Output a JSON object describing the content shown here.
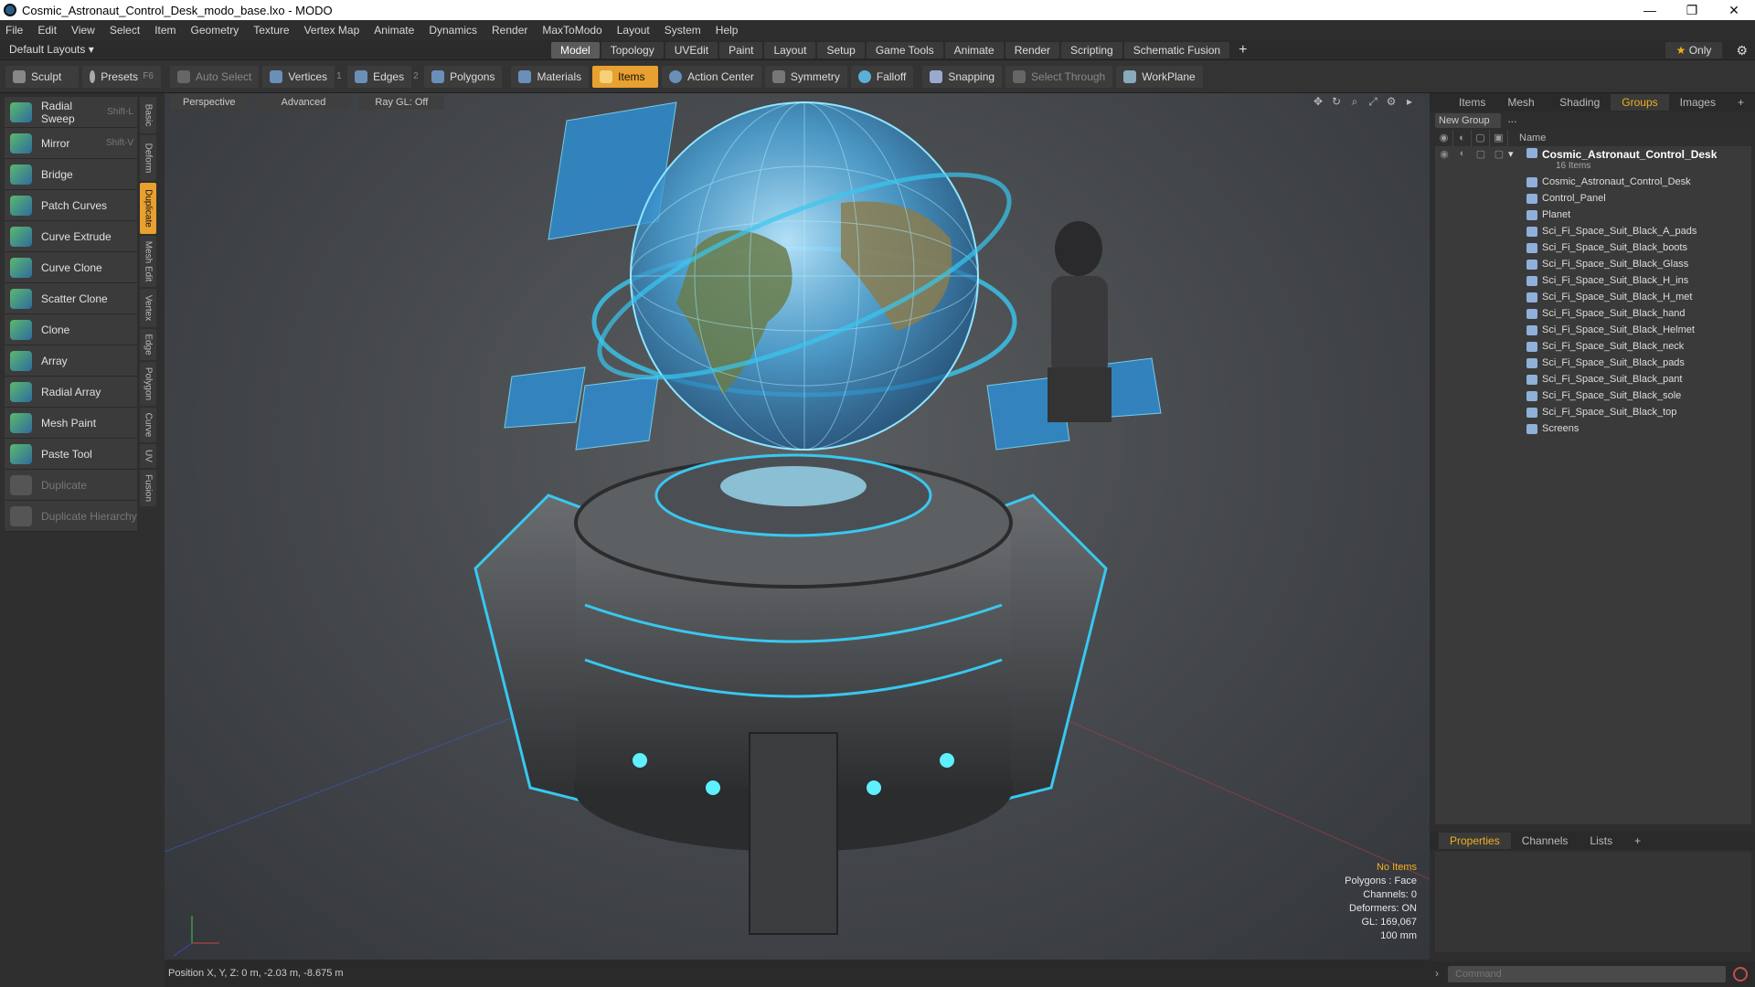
{
  "window": {
    "title": "Cosmic_Astronaut_Control_Desk_modo_base.lxo - MODO",
    "controls": [
      "—",
      "❐",
      "✕"
    ]
  },
  "menubar": [
    "File",
    "Edit",
    "View",
    "Select",
    "Item",
    "Geometry",
    "Texture",
    "Vertex Map",
    "Animate",
    "Dynamics",
    "Render",
    "MaxToModo",
    "Layout",
    "System",
    "Help"
  ],
  "layout": {
    "dropdown": "Default Layouts ▾",
    "tabs": [
      "Model",
      "Topology",
      "UVEdit",
      "Paint",
      "Layout",
      "Setup",
      "Game Tools",
      "Animate",
      "Render",
      "Scripting",
      "Schematic Fusion"
    ],
    "active_tab": "Model",
    "plus": "+",
    "only": "Only"
  },
  "toolbar": {
    "sculpt": "Sculpt",
    "presets": "Presets",
    "presets_sc": "F6",
    "auto_select": "Auto Select",
    "vertices": "Vertices",
    "vertices_n": "1",
    "edges": "Edges",
    "edges_n": "2",
    "polygons": "Polygons",
    "materials": "Materials",
    "items": "Items",
    "action_center": "Action Center",
    "symmetry": "Symmetry",
    "falloff": "Falloff",
    "snapping": "Snapping",
    "select_through": "Select Through",
    "workplane": "WorkPlane"
  },
  "tools": [
    {
      "label": "Radial Sweep",
      "shortcut": "Shift-L"
    },
    {
      "label": "Mirror",
      "shortcut": "Shift-V"
    },
    {
      "label": "Bridge",
      "shortcut": ""
    },
    {
      "label": "Patch Curves",
      "shortcut": ""
    },
    {
      "label": "Curve Extrude",
      "shortcut": ""
    },
    {
      "label": "Curve Clone",
      "shortcut": ""
    },
    {
      "label": "Scatter Clone",
      "shortcut": ""
    },
    {
      "label": "Clone",
      "shortcut": ""
    },
    {
      "label": "Array",
      "shortcut": ""
    },
    {
      "label": "Radial Array",
      "shortcut": ""
    },
    {
      "label": "Mesh Paint",
      "shortcut": ""
    },
    {
      "label": "Paste Tool",
      "shortcut": ""
    },
    {
      "label": "Duplicate",
      "shortcut": ""
    },
    {
      "label": "Duplicate Hierarchy",
      "shortcut": ""
    }
  ],
  "vtabs": [
    "Basic",
    "Deform",
    "Duplicate",
    "Mesh Edit",
    "Vertex",
    "Edge",
    "Polygon",
    "Curve",
    "UV",
    "Fusion"
  ],
  "viewport": {
    "view": "Perspective",
    "shading": "Advanced",
    "raygl": "Ray GL: Off",
    "stats": {
      "selection": "No Items",
      "polygons": "Polygons : Face",
      "channels": "Channels: 0",
      "deformers": "Deformers: ON",
      "gl": "GL: 169,067",
      "unit": "100 mm"
    }
  },
  "status": {
    "position": "Position X, Y, Z:  0 m, -2.03 m, -8.675 m"
  },
  "right": {
    "tabs": [
      "Items",
      "Mesh ...",
      "Shading",
      "Groups",
      "Images",
      "+"
    ],
    "active_tab": "Groups",
    "new_group": "New Group",
    "name_col": "Name",
    "group_name": "Cosmic_Astronaut_Control_Desk",
    "group_count": "16 Items",
    "items": [
      "Cosmic_Astronaut_Control_Desk",
      "Control_Panel",
      "Planet",
      "Sci_Fi_Space_Suit_Black_A_pads",
      "Sci_Fi_Space_Suit_Black_boots",
      "Sci_Fi_Space_Suit_Black_Glass",
      "Sci_Fi_Space_Suit_Black_H_ins",
      "Sci_Fi_Space_Suit_Black_H_met",
      "Sci_Fi_Space_Suit_Black_hand",
      "Sci_Fi_Space_Suit_Black_Helmet",
      "Sci_Fi_Space_Suit_Black_neck",
      "Sci_Fi_Space_Suit_Black_pads",
      "Sci_Fi_Space_Suit_Black_pant",
      "Sci_Fi_Space_Suit_Black_sole",
      "Sci_Fi_Space_Suit_Black_top",
      "Screens"
    ],
    "prop_tabs": [
      "Properties",
      "Channels",
      "Lists",
      "+"
    ],
    "active_prop_tab": "Properties",
    "command_placeholder": "Command"
  },
  "colors": {
    "accent": "#e8a030",
    "hologram": "#38c8f0"
  }
}
